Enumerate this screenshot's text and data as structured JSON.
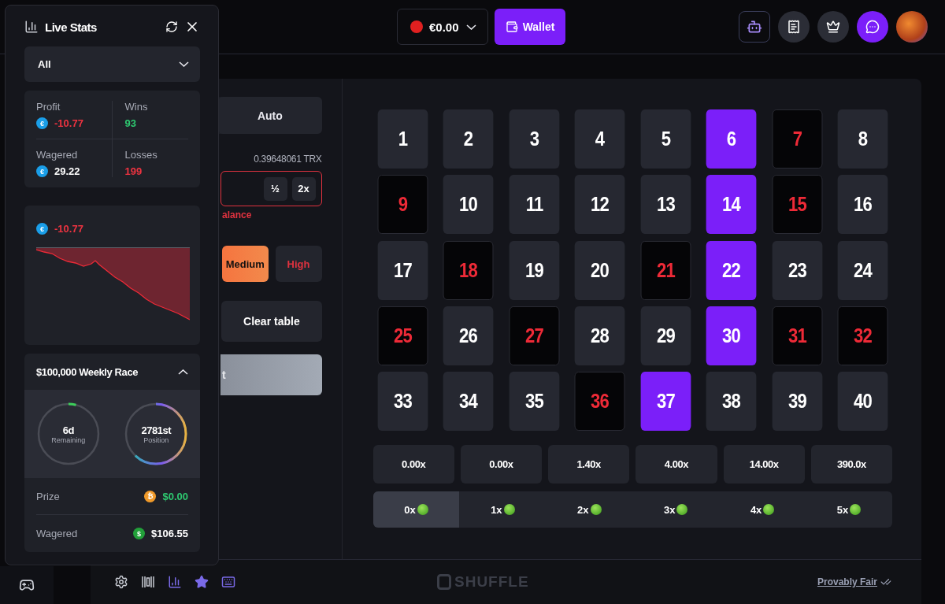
{
  "header": {
    "balance": "€0.00",
    "wallet_button": "Wallet"
  },
  "controls": {
    "mode_tab": {
      "label": "Auto",
      "selected": false
    },
    "balance_reading": "0.39648061 TRX",
    "half_button": "½",
    "double_button": "2x",
    "error_text": "alance",
    "risk": [
      {
        "label": "Medium",
        "selected": true,
        "kind": "medium"
      },
      {
        "label": "High",
        "selected": false,
        "kind": "high"
      }
    ],
    "clear_button": "Clear table",
    "bet_button": "t"
  },
  "board": {
    "tiles": [
      {
        "n": "1",
        "kind": "none"
      },
      {
        "n": "2",
        "kind": "none"
      },
      {
        "n": "3",
        "kind": "none"
      },
      {
        "n": "4",
        "kind": "none"
      },
      {
        "n": "5",
        "kind": "none"
      },
      {
        "n": "6",
        "kind": "picked"
      },
      {
        "n": "7",
        "kind": "drawn"
      },
      {
        "n": "8",
        "kind": "none"
      },
      {
        "n": "9",
        "kind": "drawn"
      },
      {
        "n": "10",
        "kind": "none"
      },
      {
        "n": "11",
        "kind": "none"
      },
      {
        "n": "12",
        "kind": "none"
      },
      {
        "n": "13",
        "kind": "none"
      },
      {
        "n": "14",
        "kind": "picked"
      },
      {
        "n": "15",
        "kind": "drawn"
      },
      {
        "n": "16",
        "kind": "none"
      },
      {
        "n": "17",
        "kind": "none"
      },
      {
        "n": "18",
        "kind": "drawn"
      },
      {
        "n": "19",
        "kind": "none"
      },
      {
        "n": "20",
        "kind": "none"
      },
      {
        "n": "21",
        "kind": "drawn"
      },
      {
        "n": "22",
        "kind": "picked"
      },
      {
        "n": "23",
        "kind": "none"
      },
      {
        "n": "24",
        "kind": "none"
      },
      {
        "n": "25",
        "kind": "drawn"
      },
      {
        "n": "26",
        "kind": "none"
      },
      {
        "n": "27",
        "kind": "drawn"
      },
      {
        "n": "28",
        "kind": "none"
      },
      {
        "n": "29",
        "kind": "none"
      },
      {
        "n": "30",
        "kind": "picked"
      },
      {
        "n": "31",
        "kind": "drawn"
      },
      {
        "n": "32",
        "kind": "drawn"
      },
      {
        "n": "33",
        "kind": "none"
      },
      {
        "n": "34",
        "kind": "none"
      },
      {
        "n": "35",
        "kind": "none"
      },
      {
        "n": "36",
        "kind": "drawn"
      },
      {
        "n": "37",
        "kind": "picked"
      },
      {
        "n": "38",
        "kind": "none"
      },
      {
        "n": "39",
        "kind": "none"
      },
      {
        "n": "40",
        "kind": "none"
      }
    ],
    "multipliers": [
      "0.00x",
      "0.00x",
      "1.40x",
      "4.00x",
      "14.00x",
      "390.0x"
    ],
    "hits": [
      {
        "label": "0x",
        "selected": true
      },
      {
        "label": "1x",
        "selected": false
      },
      {
        "label": "2x",
        "selected": false
      },
      {
        "label": "3x",
        "selected": false
      },
      {
        "label": "4x",
        "selected": false
      },
      {
        "label": "5x",
        "selected": false
      }
    ]
  },
  "footer": {
    "logo": "SHUFFLE",
    "fair_link": "Provably Fair"
  },
  "live_stats": {
    "title": "Live Stats",
    "filter": "All",
    "stats": [
      {
        "label": "Profit",
        "value": "-10.77",
        "kind": "loss",
        "coin": "€"
      },
      {
        "label": "Wins",
        "value": "93",
        "kind": "win"
      },
      {
        "label": "Wagered",
        "value": "29.22",
        "kind": "plain",
        "coin": "€"
      },
      {
        "label": "Losses",
        "value": "199",
        "kind": "loss"
      }
    ],
    "chart_coin": "€",
    "chart_profit": "-10.77",
    "race": {
      "title": "$100,000 Weekly Race",
      "expanded": true,
      "rings": [
        {
          "value": "6d",
          "caption": "Remaining"
        },
        {
          "value": "2781st",
          "caption": "Position"
        }
      ],
      "rows": [
        {
          "label": "Prize",
          "coin": "₿",
          "value": "$0.00",
          "kind": "prize"
        },
        {
          "label": "Wagered",
          "coin": "$",
          "value": "$106.55",
          "kind": "wagered"
        }
      ]
    }
  }
}
